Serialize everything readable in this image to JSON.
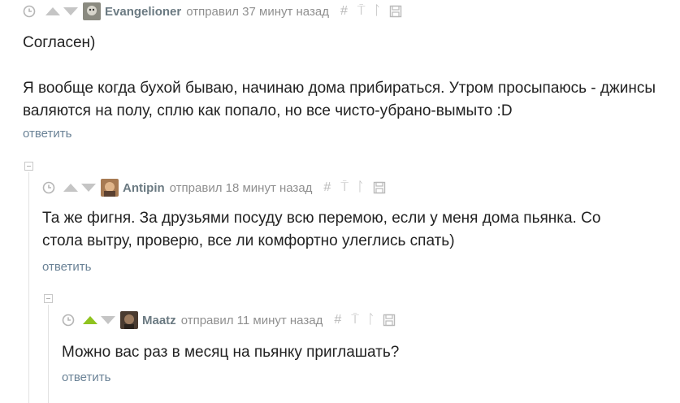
{
  "comments": [
    {
      "author": "Evangelioner",
      "meta": "отправил 37 минут назад",
      "text": "Согласен)\n\nЯ вообще когда бухой бываю, начинаю дома прибираться. Утром просыпаюсь - джинсы валяются на полу, сплю как попало, но все чисто-убрано-вымыто :D",
      "reply": "ответить",
      "voted_up": false
    },
    {
      "author": "Antipin",
      "meta": "отправил 18 минут назад",
      "text": "Та же фигня. За друзьями посуду всю перемою, если у меня дома пьянка. Со стола вытру, проверю, все ли комфортно улеглись спать)",
      "reply": "ответить",
      "voted_up": false
    },
    {
      "author": "Maatz",
      "meta": "отправил 11 минут назад",
      "text": "Можно вас раз в месяц на пьянку приглашать?",
      "reply": "ответить",
      "voted_up": true
    }
  ],
  "tools": {
    "hash": "#",
    "pin": "⍑",
    "branch": "ᛚ"
  },
  "colors": {
    "author": "#6b7a82",
    "meta": "#8f8f8f",
    "reply": "#6a8296",
    "vote_up_active": "#8fc31f",
    "vote_inactive": "#c5c5c5"
  }
}
